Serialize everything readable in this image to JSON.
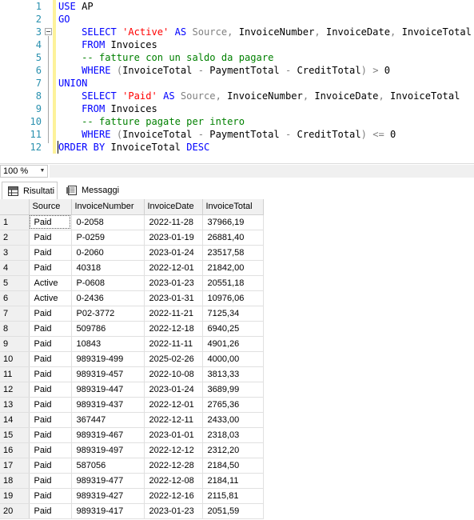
{
  "editor": {
    "lines": [
      {
        "n": "1",
        "tokens": [
          [
            "kw",
            "USE"
          ],
          [
            "",
            " AP"
          ]
        ]
      },
      {
        "n": "2",
        "tokens": [
          [
            "kw",
            "GO"
          ]
        ]
      },
      {
        "n": "3",
        "tokens": [
          [
            "",
            "    "
          ],
          [
            "kw",
            "SELECT"
          ],
          [
            "",
            " "
          ],
          [
            "str",
            "'Active'"
          ],
          [
            "",
            " "
          ],
          [
            "kw",
            "AS"
          ],
          [
            "",
            " "
          ],
          [
            "op",
            "Source"
          ],
          [
            "op",
            ","
          ],
          [
            "",
            " InvoiceNumber"
          ],
          [
            "op",
            ","
          ],
          [
            "",
            " InvoiceDate"
          ],
          [
            "op",
            ","
          ],
          [
            "",
            " InvoiceTotal"
          ]
        ]
      },
      {
        "n": "4",
        "tokens": [
          [
            "",
            "    "
          ],
          [
            "kw",
            "FROM"
          ],
          [
            "",
            " Invoices"
          ]
        ]
      },
      {
        "n": "5",
        "tokens": [
          [
            "",
            "    "
          ],
          [
            "cm",
            "-- fatture con un saldo da pagare"
          ]
        ]
      },
      {
        "n": "6",
        "tokens": [
          [
            "",
            "    "
          ],
          [
            "kw",
            "WHERE"
          ],
          [
            "",
            " "
          ],
          [
            "op",
            "("
          ],
          [
            "",
            "InvoiceTotal "
          ],
          [
            "op",
            "-"
          ],
          [
            "",
            " PaymentTotal "
          ],
          [
            "op",
            "-"
          ],
          [
            "",
            " CreditTotal"
          ],
          [
            "op",
            ")"
          ],
          [
            "",
            " "
          ],
          [
            "op",
            ">"
          ],
          [
            "",
            " 0"
          ]
        ]
      },
      {
        "n": "7",
        "tokens": [
          [
            "kw",
            "UNION"
          ]
        ]
      },
      {
        "n": "8",
        "tokens": [
          [
            "",
            "    "
          ],
          [
            "kw",
            "SELECT"
          ],
          [
            "",
            " "
          ],
          [
            "str",
            "'Paid'"
          ],
          [
            "",
            " "
          ],
          [
            "kw",
            "AS"
          ],
          [
            "",
            " "
          ],
          [
            "op",
            "Source"
          ],
          [
            "op",
            ","
          ],
          [
            "",
            " InvoiceNumber"
          ],
          [
            "op",
            ","
          ],
          [
            "",
            " InvoiceDate"
          ],
          [
            "op",
            ","
          ],
          [
            "",
            " InvoiceTotal"
          ]
        ]
      },
      {
        "n": "9",
        "tokens": [
          [
            "",
            "    "
          ],
          [
            "kw",
            "FROM"
          ],
          [
            "",
            " Invoices"
          ]
        ]
      },
      {
        "n": "10",
        "tokens": [
          [
            "",
            "    "
          ],
          [
            "cm",
            "-- fatture pagate per intero"
          ]
        ]
      },
      {
        "n": "11",
        "tokens": [
          [
            "",
            "    "
          ],
          [
            "kw",
            "WHERE"
          ],
          [
            "",
            " "
          ],
          [
            "op",
            "("
          ],
          [
            "",
            "InvoiceTotal "
          ],
          [
            "op",
            "-"
          ],
          [
            "",
            " PaymentTotal "
          ],
          [
            "op",
            "-"
          ],
          [
            "",
            " CreditTotal"
          ],
          [
            "op",
            ")"
          ],
          [
            "",
            " "
          ],
          [
            "op",
            "<="
          ],
          [
            "",
            " 0"
          ]
        ]
      },
      {
        "n": "12",
        "tokens": [
          [
            "kw",
            "ORDER BY"
          ],
          [
            "",
            " InvoiceTotal "
          ],
          [
            "kw",
            "DESC"
          ]
        ]
      }
    ]
  },
  "zoom": {
    "value": "100 %"
  },
  "tabs": {
    "results_label": "Risultati",
    "messages_label": "Messaggi"
  },
  "grid": {
    "columns": [
      "Source",
      "InvoiceNumber",
      "InvoiceDate",
      "InvoiceTotal"
    ],
    "rows": [
      [
        "1",
        "Paid",
        "0-2058",
        "2022-11-28",
        "37966,19"
      ],
      [
        "2",
        "Paid",
        "P-0259",
        "2023-01-19",
        "26881,40"
      ],
      [
        "3",
        "Paid",
        "0-2060",
        "2023-01-24",
        "23517,58"
      ],
      [
        "4",
        "Paid",
        "40318",
        "2022-12-01",
        "21842,00"
      ],
      [
        "5",
        "Active",
        "P-0608",
        "2023-01-23",
        "20551,18"
      ],
      [
        "6",
        "Active",
        "0-2436",
        "2023-01-31",
        "10976,06"
      ],
      [
        "7",
        "Paid",
        "P02-3772",
        "2022-11-21",
        "7125,34"
      ],
      [
        "8",
        "Paid",
        "509786",
        "2022-12-18",
        "6940,25"
      ],
      [
        "9",
        "Paid",
        "10843",
        "2022-11-11",
        "4901,26"
      ],
      [
        "10",
        "Paid",
        "989319-499",
        "2025-02-26",
        "4000,00"
      ],
      [
        "11",
        "Paid",
        "989319-457",
        "2022-10-08",
        "3813,33"
      ],
      [
        "12",
        "Paid",
        "989319-447",
        "2023-01-24",
        "3689,99"
      ],
      [
        "13",
        "Paid",
        "989319-437",
        "2022-12-01",
        "2765,36"
      ],
      [
        "14",
        "Paid",
        "367447",
        "2022-12-11",
        "2433,00"
      ],
      [
        "15",
        "Paid",
        "989319-467",
        "2023-01-01",
        "2318,03"
      ],
      [
        "16",
        "Paid",
        "989319-497",
        "2022-12-12",
        "2312,20"
      ],
      [
        "17",
        "Paid",
        "587056",
        "2022-12-28",
        "2184,50"
      ],
      [
        "18",
        "Paid",
        "989319-477",
        "2022-12-08",
        "2184,11"
      ],
      [
        "19",
        "Paid",
        "989319-427",
        "2022-12-16",
        "2115,81"
      ],
      [
        "20",
        "Paid",
        "989319-417",
        "2023-01-23",
        "2051,59"
      ]
    ]
  }
}
